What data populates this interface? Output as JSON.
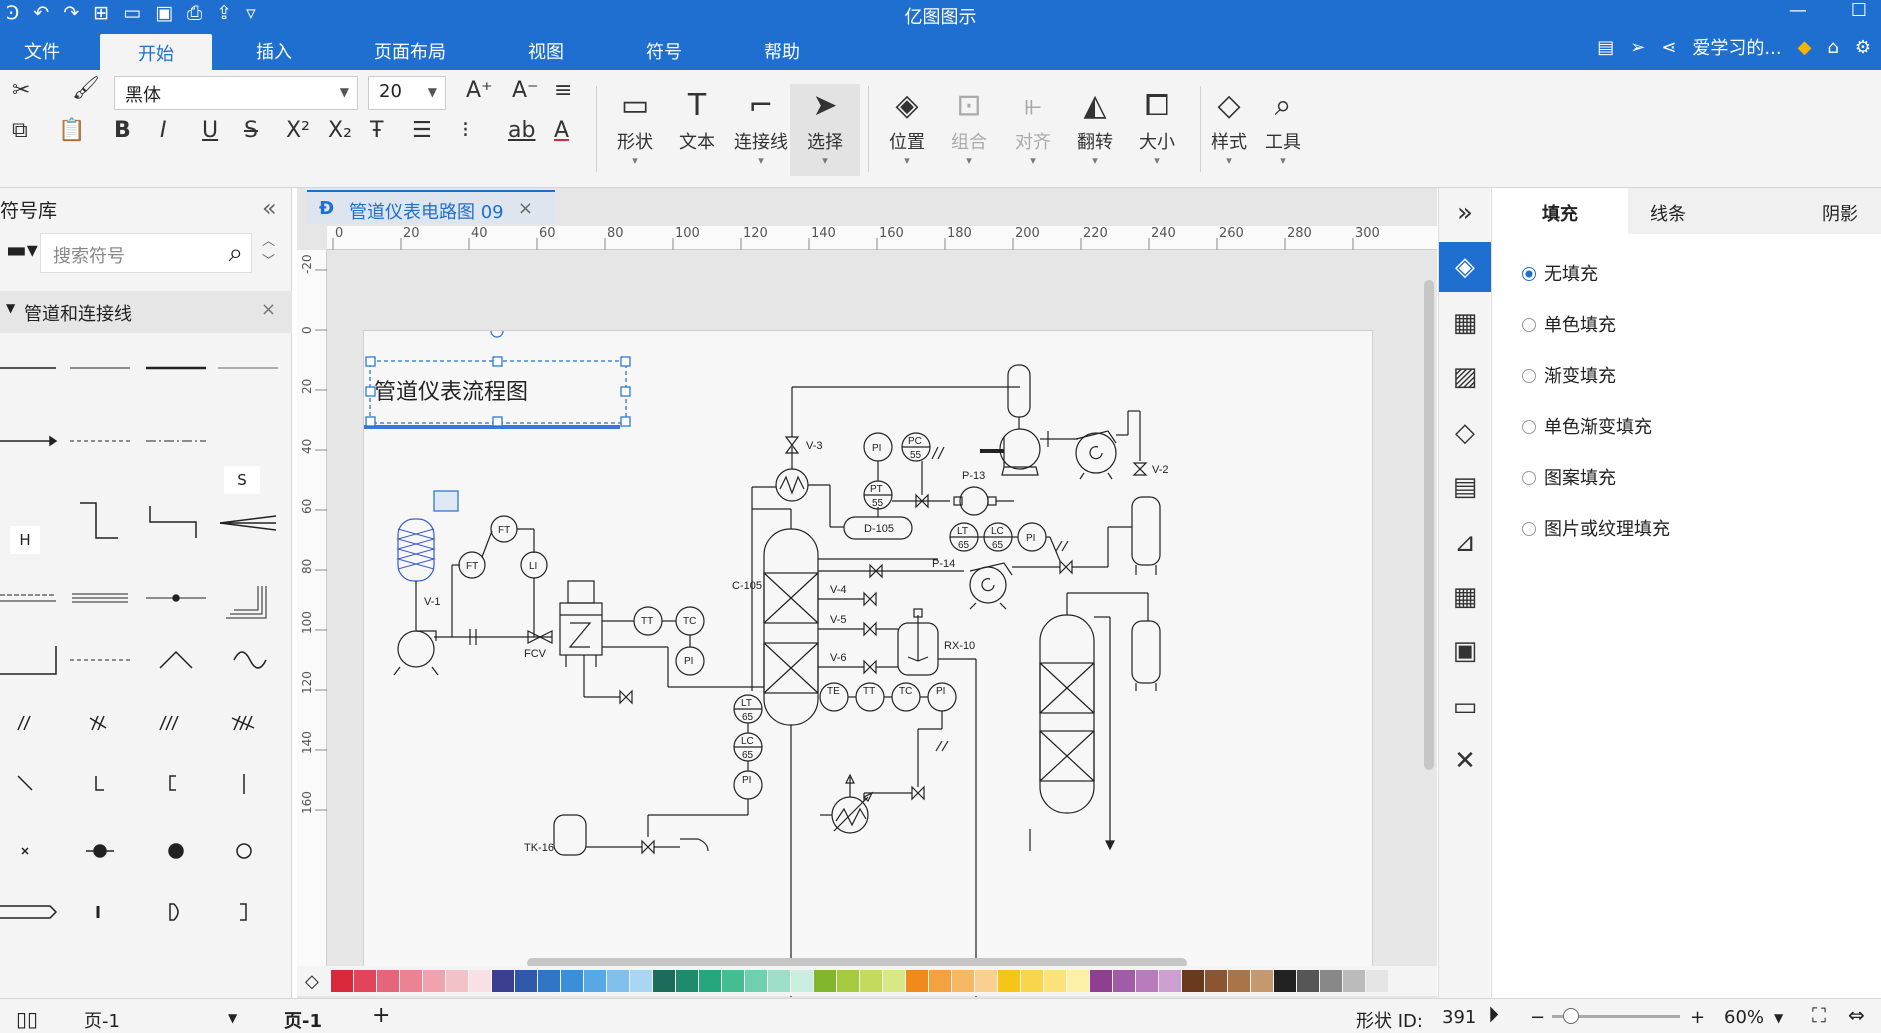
{
  "app": {
    "title": "亿图图示"
  },
  "menu": {
    "items": [
      "文件",
      "开始",
      "插入",
      "页面布局",
      "视图",
      "符号",
      "帮助"
    ],
    "active": "开始",
    "user": "爱学习的..."
  },
  "ribbon": {
    "font_family": "黑体",
    "font_size": "20",
    "buttons": [
      "形状",
      "文本",
      "连接线",
      "选择",
      "位置",
      "组合",
      "对齐",
      "翻转",
      "大小",
      "样式",
      "工具"
    ]
  },
  "library": {
    "title": "符号库",
    "search_placeholder": "搜索符号",
    "category": "管道和连接线",
    "symbol_labels": [
      "S",
      "H"
    ]
  },
  "document": {
    "tab": "管道仪表电路图 09",
    "ruler_h": [
      "0",
      "20",
      "40",
      "60",
      "80",
      "100",
      "120",
      "140",
      "160",
      "180",
      "200",
      "220",
      "240",
      "260",
      "280",
      "300"
    ],
    "ruler_v": [
      "-20",
      "0",
      "20",
      "40",
      "60",
      "80",
      "100",
      "120",
      "140",
      "160"
    ],
    "diagram_title": "管道仪表流程图",
    "labels": {
      "v1": "V-1",
      "v2": "V-2",
      "v3": "V-3",
      "v4": "V-4",
      "v5": "V-5",
      "v6": "V-6",
      "fcv": "FCV",
      "c105": "C-105",
      "d105": "D-105",
      "p13": "P-13",
      "p14": "P-14",
      "rx10": "RX-10",
      "tk16": "TK-16"
    },
    "instruments": {
      "ft1": "FT",
      "ft2": "FT",
      "li": "LI",
      "tt1": "TT",
      "tc1": "TC",
      "pi1": "PI",
      "pi2": "PI",
      "pc": "PC",
      "pc_n": "55",
      "pt": "PT",
      "pt_n": "55",
      "lt1": "LT",
      "lt1_n": "65",
      "lc1": "LC",
      "lc1_n": "65",
      "pi3": "PI",
      "lt2": "LT",
      "lt2_n": "65",
      "lc2": "LC",
      "lc2_n": "65",
      "pi4": "PI",
      "te": "TE",
      "tt2": "TT",
      "tc2": "TC",
      "pi5": "PI"
    }
  },
  "props": {
    "tabs": [
      "填充",
      "线条",
      "阴影"
    ],
    "fill_options": [
      "无填充",
      "单色填充",
      "渐变填充",
      "单色渐变填充",
      "图案填充",
      "图片或纹理填充"
    ],
    "selected_fill": "无填充"
  },
  "status": {
    "page_select": "页-1",
    "page_tab": "页-1",
    "shape_id_label": "形状 ID:",
    "shape_id": "391",
    "zoom": "60%"
  },
  "colors": {
    "accent": "#1e6fd0",
    "handle": "#1e6fd0",
    "palette": [
      "#d9283b",
      "#e0455a",
      "#e5667a",
      "#ea8494",
      "#efa3ae",
      "#f3c1c8",
      "#f8e0e4",
      "#3a3f8f",
      "#2e58a8",
      "#2f75c6",
      "#3b8fd8",
      "#57a8e4",
      "#7fc0ec",
      "#a9d6f3",
      "#1d6b5a",
      "#1f8a6c",
      "#26a67f",
      "#45bd93",
      "#6fcfae",
      "#9ddec8",
      "#c9eedf",
      "#82b72d",
      "#a5c93f",
      "#c2db5e",
      "#d8e887",
      "#f08a1c",
      "#f4a23f",
      "#f7b866",
      "#fbcf92",
      "#f5c518",
      "#f8d54a",
      "#fbe27a",
      "#fdeea8",
      "#8e3f8f",
      "#a25ba6",
      "#b87cbd",
      "#cea0d2",
      "#6b3a1e",
      "#8a5530",
      "#a87448",
      "#c59870",
      "#222222",
      "#555555",
      "#888888",
      "#bbbbbb",
      "#e5e5e5"
    ]
  }
}
